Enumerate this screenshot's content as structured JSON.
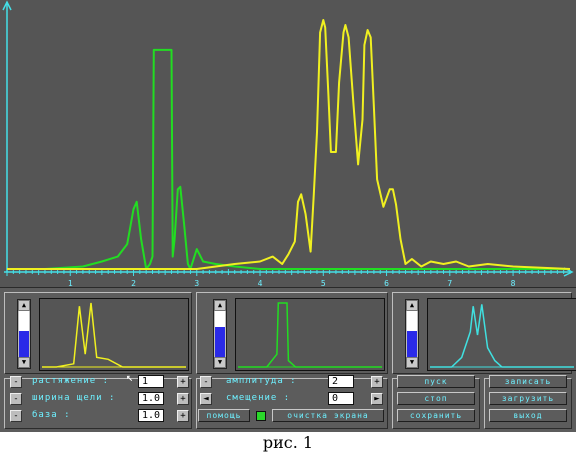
{
  "axis": {
    "tick_labels": [
      "1",
      "2",
      "3",
      "4",
      "5",
      "6",
      "7",
      "8"
    ],
    "x_range": [
      0,
      8.9
    ],
    "y_range": [
      0,
      1
    ]
  },
  "colors": {
    "background": "#555555",
    "green_trace": "#22dd22",
    "yellow_trace": "#f0f020",
    "cyan_trace": "#40e0e0",
    "axis": "#44e0e8",
    "labels": "#6ef0ff",
    "scroll_fill": "#2a2ae8"
  },
  "chart_data": [
    {
      "name_note": "",
      "type": "line",
      "series": [
        {
          "color": "green",
          "x": [
            0.6,
            1.2,
            1.5,
            1.75,
            1.9,
            2.0,
            2.05,
            2.12,
            2.2,
            2.26,
            2.3,
            2.32,
            2.6,
            2.62,
            2.65,
            2.7,
            2.74,
            2.8,
            2.86,
            2.9,
            3.0,
            3.1,
            3.3,
            3.6,
            4.0,
            8.9
          ],
          "y": [
            0,
            0.01,
            0.03,
            0.05,
            0.1,
            0.24,
            0.27,
            0.12,
            0.0,
            0.02,
            0.05,
            0.88,
            0.88,
            0.05,
            0.12,
            0.32,
            0.33,
            0.18,
            0.02,
            0.0,
            0.08,
            0.03,
            0.02,
            0.01,
            0.0,
            0.0
          ]
        },
        {
          "color": "yellow",
          "x": [
            0.0,
            3.0,
            3.3,
            3.6,
            4.0,
            4.2,
            4.35,
            4.45,
            4.55,
            4.6,
            4.65,
            4.72,
            4.8,
            4.85,
            4.9,
            4.95,
            5.0,
            5.03,
            5.08,
            5.12,
            5.2,
            5.25,
            5.32,
            5.35,
            5.4,
            5.48,
            5.55,
            5.62,
            5.65,
            5.7,
            5.75,
            5.8,
            5.85,
            5.95,
            6.05,
            6.1,
            6.15,
            6.22,
            6.3,
            6.4,
            6.55,
            6.7,
            6.9,
            7.1,
            7.3,
            7.6,
            8.0,
            8.9
          ],
          "y": [
            0.0,
            0.0,
            0.01,
            0.02,
            0.03,
            0.05,
            0.02,
            0.06,
            0.11,
            0.27,
            0.3,
            0.22,
            0.07,
            0.3,
            0.55,
            0.95,
            1.0,
            0.97,
            0.7,
            0.47,
            0.47,
            0.75,
            0.95,
            0.98,
            0.93,
            0.65,
            0.42,
            0.6,
            0.9,
            0.96,
            0.93,
            0.65,
            0.36,
            0.25,
            0.32,
            0.32,
            0.26,
            0.12,
            0.02,
            0.04,
            0.01,
            0.03,
            0.02,
            0.03,
            0.01,
            0.02,
            0.01,
            0.0
          ]
        }
      ],
      "xlim": [
        0,
        8.9
      ],
      "ticks": [
        1,
        2,
        3,
        4,
        5,
        6,
        7,
        8
      ]
    },
    {
      "type": "line",
      "series": [
        {
          "color": "yellow",
          "x": [
            0,
            0.1,
            0.22,
            0.26,
            0.3,
            0.34,
            0.38,
            0.46,
            0.56,
            1.0
          ],
          "y": [
            0,
            0,
            0.05,
            0.95,
            0.2,
            1.0,
            0.15,
            0.12,
            0,
            0
          ]
        }
      ]
    },
    {
      "type": "line",
      "series": [
        {
          "color": "green",
          "x": [
            0,
            0.2,
            0.27,
            0.28,
            0.34,
            0.35,
            0.4,
            1.0
          ],
          "y": [
            0,
            0,
            0.2,
            1.0,
            1.0,
            0.1,
            0,
            0
          ]
        }
      ]
    },
    {
      "type": "line",
      "series": [
        {
          "color": "cyan",
          "x": [
            0,
            0.15,
            0.22,
            0.28,
            0.3,
            0.33,
            0.36,
            0.4,
            0.45,
            0.5,
            1.0
          ],
          "y": [
            0,
            0,
            0.15,
            0.55,
            0.95,
            0.5,
            0.98,
            0.3,
            0.1,
            0,
            0
          ]
        }
      ]
    }
  ],
  "panel": {
    "stretch_label": "растяжение  :",
    "stretch_value": "1",
    "slit_label": "ширина щели  :",
    "slit_value": "1.0",
    "base_label": "база        :",
    "base_value": "1.0",
    "amplitude_label": "амплитуда  :",
    "amplitude_value": "2",
    "offset_label": "смещение   :",
    "offset_value": "0",
    "help_label": "помощь",
    "clear_label": "очистка экрана",
    "start_label": "пуск",
    "stop_label": "стоп",
    "save_label": "сохранить",
    "write_label": "записать",
    "load_label": "загрузить",
    "exit_label": "выход",
    "minus": "-",
    "plus": "+",
    "left_arrow": "◄",
    "right_arrow": "►",
    "up_arrow": "▲",
    "down_arrow": "▼",
    "scroll_levels": [
      0.5,
      0.6,
      0.5
    ]
  },
  "caption": "рис. 1",
  "icons": {
    "cursor": "mouse-pointer-icon"
  }
}
